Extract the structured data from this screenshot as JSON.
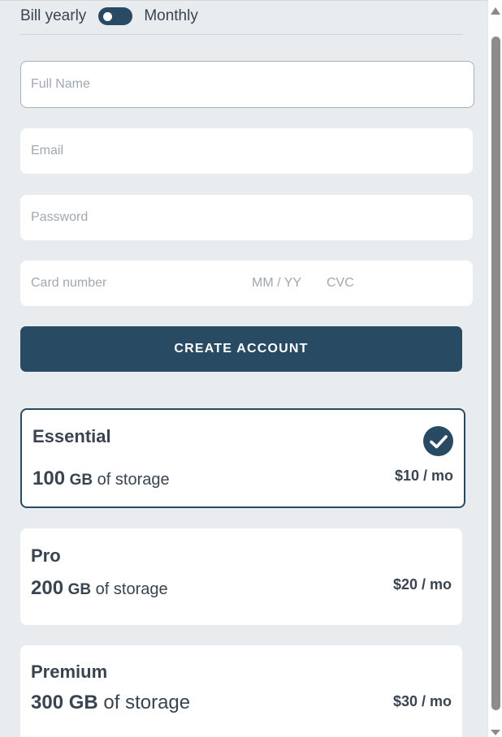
{
  "billing": {
    "yearly_label": "Bill yearly",
    "monthly_label": "Monthly"
  },
  "form": {
    "full_name_placeholder": "Full Name",
    "email_placeholder": "Email",
    "password_placeholder": "Password",
    "card_number_placeholder": "Card number",
    "expiry_placeholder": "MM / YY",
    "cvc_placeholder": "CVC",
    "submit_label": "CREATE ACCOUNT"
  },
  "plans": [
    {
      "name": "Essential",
      "amount": "100",
      "unit": "GB",
      "suffix": "of storage",
      "price": "$10 / mo",
      "selected": true
    },
    {
      "name": "Pro",
      "amount": "200",
      "unit": "GB",
      "suffix": "of storage",
      "price": "$20 / mo",
      "selected": false
    },
    {
      "name": "Premium",
      "amount": "300",
      "unit": "GB",
      "suffix": "of storage",
      "price": "$30 / mo",
      "selected": false
    }
  ],
  "colors": {
    "accent": "#284a63",
    "background": "#e8ecef",
    "card": "#ffffff",
    "text": "#3a4450",
    "placeholder": "#a0a8b1"
  }
}
